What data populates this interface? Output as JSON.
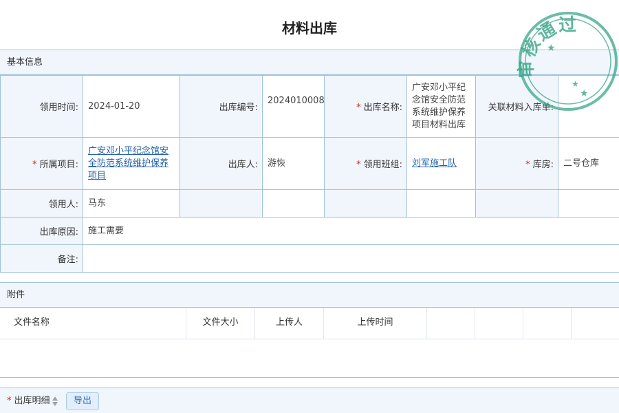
{
  "page": {
    "title": "材料出库"
  },
  "basic_info": {
    "section_label": "基本信息",
    "fields": {
      "receive_time": {
        "label": "领用时间:",
        "value": "2024-01-20"
      },
      "outbound_no": {
        "label": "出库编号:",
        "value": "2024010008"
      },
      "outbound_name": {
        "label": "出库名称:",
        "value": "广安邓小平纪念馆安全防范系统维护保养项目材料出库",
        "required": true
      },
      "linked_inbound": {
        "label": "关联材料入库单:",
        "value": ""
      },
      "project": {
        "label": "所属项目:",
        "value": "广安邓小平纪念馆安全防范系统维护保养项目",
        "required": true
      },
      "outbound_by": {
        "label": "出库人:",
        "value": "游恢"
      },
      "team": {
        "label": "领用班组:",
        "value": "刘军施工队",
        "required": true
      },
      "warehouse": {
        "label": "库房:",
        "value": "二号仓库",
        "required": true
      },
      "receiver": {
        "label": "领用人:",
        "value": "马东"
      },
      "reason": {
        "label": "出库原因:",
        "value": "施工需要"
      },
      "remark": {
        "label": "备注:",
        "value": ""
      }
    }
  },
  "attachments": {
    "section_label": "附件",
    "columns": [
      "文件名称",
      "文件大小",
      "上传人",
      "上传时间"
    ],
    "rows": []
  },
  "details": {
    "label": "出库明细",
    "required": true,
    "export_label": "导出"
  },
  "stamp": {
    "text": "审核通过",
    "color": "#3aa58a"
  }
}
